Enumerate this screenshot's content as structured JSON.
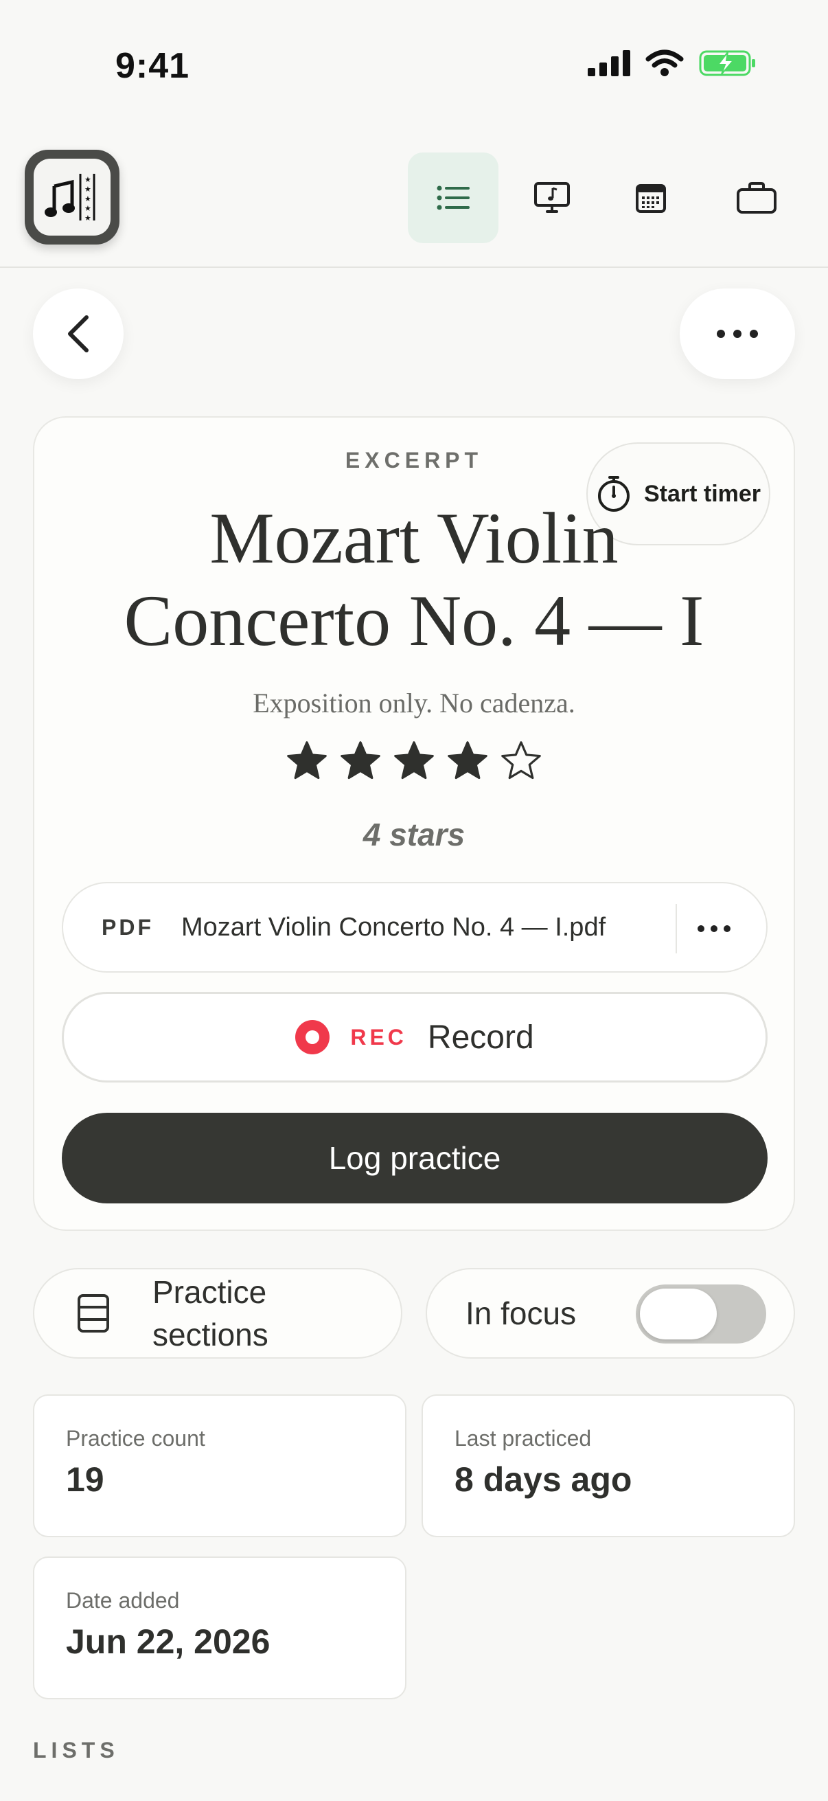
{
  "status_bar": {
    "time": "9:41"
  },
  "nav": {
    "tabs": [
      {
        "name": "list",
        "active": true
      },
      {
        "name": "performance",
        "active": false
      },
      {
        "name": "calendar",
        "active": false
      },
      {
        "name": "briefcase",
        "active": false
      }
    ]
  },
  "item": {
    "category": "EXCERPT",
    "title": "Mozart Violin Concerto No. 4 — I",
    "note": "Exposition only. No cadenza.",
    "rating": 4,
    "rating_max": 5,
    "rating_text": "4 stars",
    "timer_label": "Start timer",
    "attachment": {
      "type": "PDF",
      "filename": "Mozart Violin Concerto No. 4 — I.pdf"
    },
    "record": {
      "tag": "REC",
      "label": "Record"
    },
    "log_label": "Log practice"
  },
  "options": {
    "sections_label": "Practice sections",
    "focus_label": "In focus",
    "focus_on": false
  },
  "stats": {
    "practice_count_label": "Practice count",
    "practice_count": "19",
    "last_practiced_label": "Last practiced",
    "last_practiced": "8 days ago",
    "date_added_label": "Date added",
    "date_added": "Jun 22, 2026"
  },
  "lists_heading": "LISTS",
  "colors": {
    "accent_green": "#e6f1ea",
    "record_red": "#f0394b",
    "primary_dark": "#363733",
    "battery_green": "#4cd964"
  }
}
